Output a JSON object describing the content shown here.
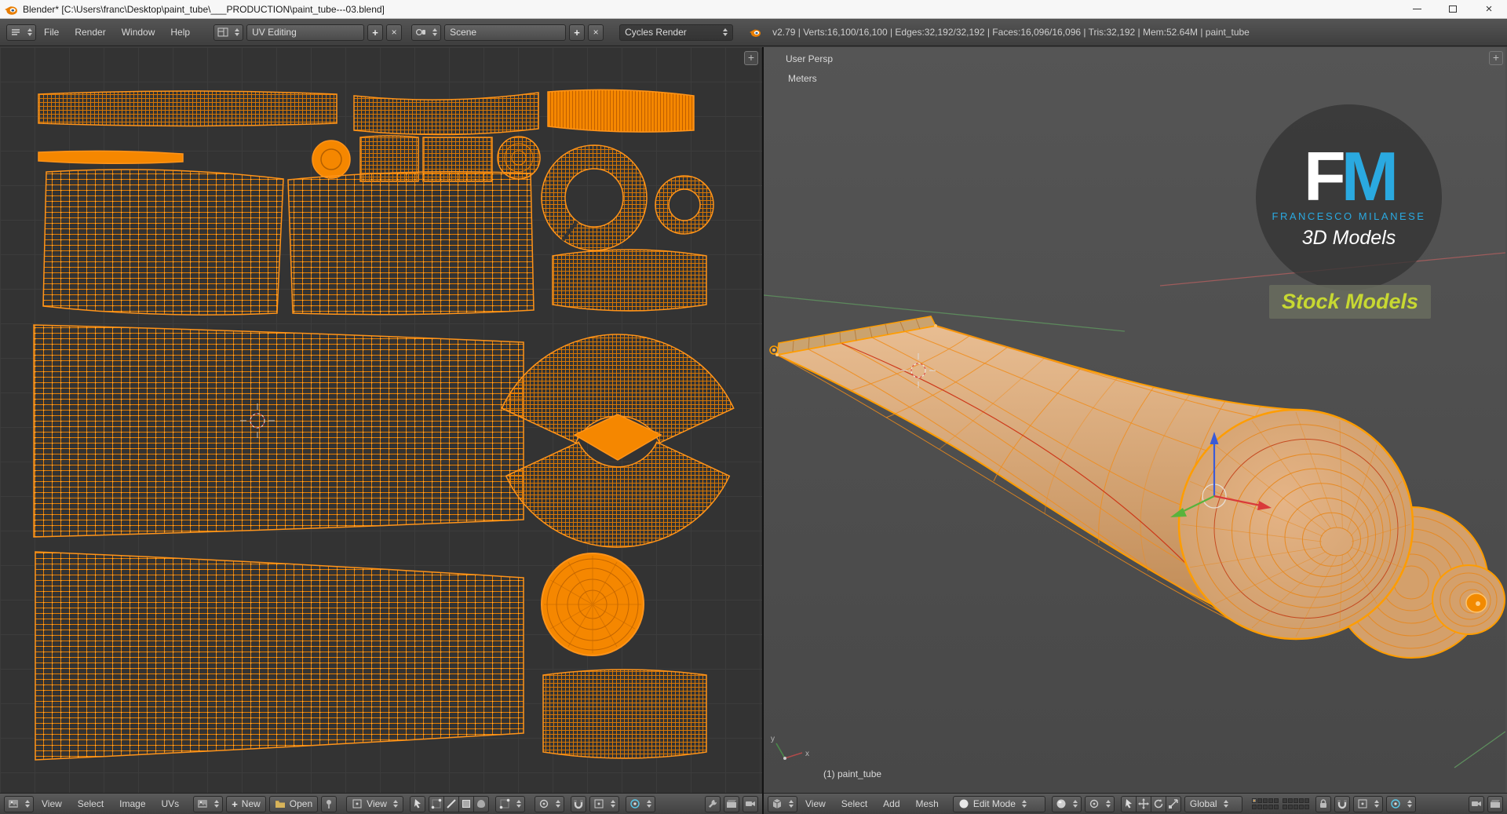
{
  "window": {
    "title": "Blender* [C:\\Users\\franc\\Desktop\\paint_tube\\___PRODUCTION\\paint_tube---03.blend]"
  },
  "info_bar": {
    "menus": [
      "File",
      "Render",
      "Window",
      "Help"
    ],
    "layout_value": "UV Editing",
    "scene_value": "Scene",
    "engine_value": "Cycles Render",
    "stats": "v2.79 | Verts:16,100/16,100 | Edges:32,192/32,192 | Faces:16,096/16,096 | Tris:32,192 | Mem:52.64M | paint_tube"
  },
  "uv_editor": {
    "menus": [
      "View",
      "Select",
      "Image",
      "UVs"
    ],
    "new_button": "New",
    "open_button": "Open",
    "display_dropdown": "View"
  },
  "viewport": {
    "view_name": "User Persp",
    "units": "Meters",
    "object_info": "(1) paint_tube",
    "menus": [
      "View",
      "Select",
      "Add",
      "Mesh"
    ],
    "mode_value": "Edit Mode",
    "orientation_value": "Global",
    "axis_labels": {
      "x": "x",
      "y": "y"
    },
    "watermark": {
      "initial_f": "F",
      "initial_m": "M",
      "name": "FRANCESCO MILANESE",
      "tagline": "3D Models",
      "badge": "Stock Models"
    }
  },
  "icons": {
    "plus": "+",
    "close": "×"
  },
  "colors": {
    "selection_orange": "#ff9d00",
    "island_orange": "#f58700",
    "tube_body_tan": "#d8a878",
    "logo_blue": "#2aa9e0",
    "badge_green": "#c7d832",
    "header_gray": "#4a4a4a",
    "uv_background": "#333333",
    "viewport_background": "#4e4e4e"
  }
}
